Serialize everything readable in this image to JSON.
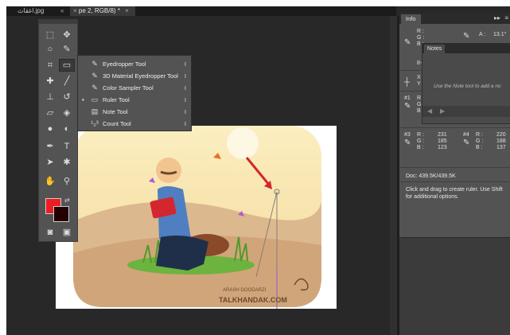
{
  "tabs": {
    "file_tab": "اغقاث.jpg",
    "active_tab": "pe 2, RGB/8) *",
    "close_glyph": "×",
    "arrows_glyph": "«"
  },
  "toolbox": {
    "foreground_color": "#ed1c24",
    "background_color": "#220000"
  },
  "flyout": {
    "items": [
      {
        "label": "Eyedropper Tool",
        "key": "I",
        "icon": "eyedropper-icon"
      },
      {
        "label": "3D Material Eyedropper Tool",
        "key": "I",
        "icon": "3d-material-eyedropper-icon"
      },
      {
        "label": "Color Sampler Tool",
        "key": "I",
        "icon": "color-sampler-icon"
      },
      {
        "label": "Ruler Tool",
        "key": "I",
        "icon": "ruler-icon",
        "selected": true
      },
      {
        "label": "Note Tool",
        "key": "I",
        "icon": "note-icon"
      },
      {
        "label": "Count Tool",
        "key": "I",
        "icon": "count-icon"
      }
    ]
  },
  "info_panel": {
    "tab_label": "Info",
    "r_label": "R :",
    "g_label": "G :",
    "b_label": "B :",
    "a_label": "A :",
    "a_value": "13.1°",
    "bit_label": "8-bi",
    "x_label": "X",
    "y_label": "Y",
    "sampler1_label": "#1",
    "sampler3_label": "#3",
    "sampler4_label": "#4",
    "s3_r": "231",
    "s3_g": "185",
    "s3_b": "123",
    "s4_r": "220",
    "s4_g": "188",
    "s4_b": "137",
    "doc_info": "Doc: 439.5K/439.5K",
    "help_text": "Click and drag to create ruler.  Use Shift for additional options."
  },
  "notes_panel": {
    "tab_label": "Notes",
    "hint": "Use the Note tool to add a no"
  },
  "artwork": {
    "caption": "TALKHANDAK.COM",
    "signature": "ARASH GOODARZI"
  }
}
